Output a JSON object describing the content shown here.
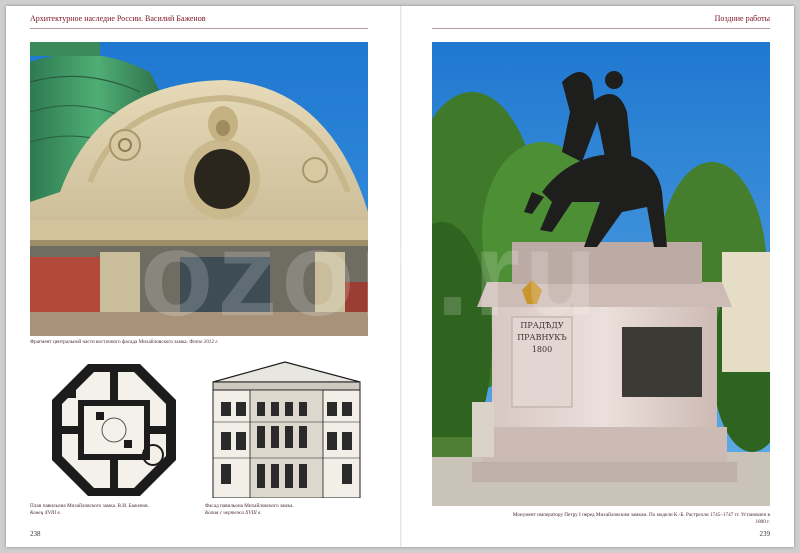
{
  "header": {
    "left": "Архитектурное наследие России. Василий Баженов",
    "right": "Поздние работы"
  },
  "captions": {
    "dome_fragment": "Фрагмент центральной части восточного фасада Михайловского замка.",
    "dome_fragment_photo": "Фото 2012 г.",
    "plan": "План павильона Михайловского замка. В.И. Баженов.",
    "plan_date": "Конец XVIII в.",
    "facade": "Фасад павильона Михайловского замка.",
    "facade_source": "Копия с чертежа XVIII в.",
    "monument": "Монумент императору Петру I перед Михайловским замком. По модели К.-Б. Растрелли 1745–1747 гг. Установлен в 1800 г."
  },
  "monument_inscription": {
    "line1": "ПРАДѢДУ",
    "line2": "ПРАВНУКЪ",
    "year": "1800"
  },
  "pages": {
    "left": "238",
    "right": "239"
  },
  "watermark": "ozon.ru",
  "colors": {
    "accent": "#7a1020",
    "sky": "#2f86d6",
    "stone": "#d9c8a6"
  }
}
